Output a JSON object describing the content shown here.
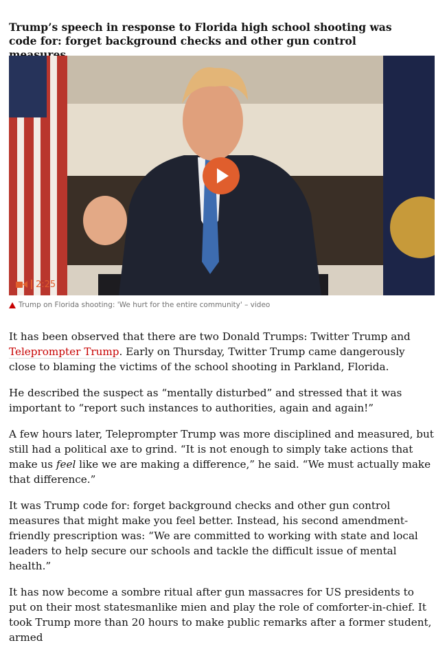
{
  "headline": "Trump’s speech in response to Florida high school shooting was code for: forget background checks and other gun control measures",
  "video": {
    "duration": "2:25",
    "camera_icon": "video-camera-icon",
    "play_icon": "play-icon",
    "accent_color": "#e05e2d"
  },
  "caption": {
    "icon": "red-triangle-icon",
    "text": "Trump on Florida shooting: 'We hurt for the entire community' – video"
  },
  "article": {
    "p1_before": "It has been observed that there are two Donald Trumps: Twitter Trump and ",
    "p1_link": "Teleprompter Trump",
    "p1_after": ". Early on Thursday, Twitter Trump came dangerously close to blaming the victims of the school shooting in Parkland, Florida.",
    "p2": "He described the suspect as “mentally disturbed” and stressed that it was important to “report such instances to authorities, again and again!”",
    "p3_before": "A few hours later, Teleprompter Trump was more disciplined and measured, but still had a political axe to grind. “It is not enough to simply take actions that make us ",
    "p3_em": "feel",
    "p3_after": " like we are making a difference,” he said. “We must actually make that difference.”",
    "p4": "It was Trump code for: forget background checks and other gun control measures that might make you feel better. Instead, his second amendment-friendly prescription was: “We are committed to working with state and local leaders to help secure our schools and tackle the difficult issue of mental health.”",
    "p5": "It has now become a sombre ritual after gun massacres for US presidents to put on their most statesmanlike mien and play the role of comforter-in-chief. It took Trump more than 20 hours to make public remarks after a former student, armed"
  },
  "colors": {
    "link": "#c70000",
    "caption_text": "#707070",
    "body_text": "#121212"
  }
}
